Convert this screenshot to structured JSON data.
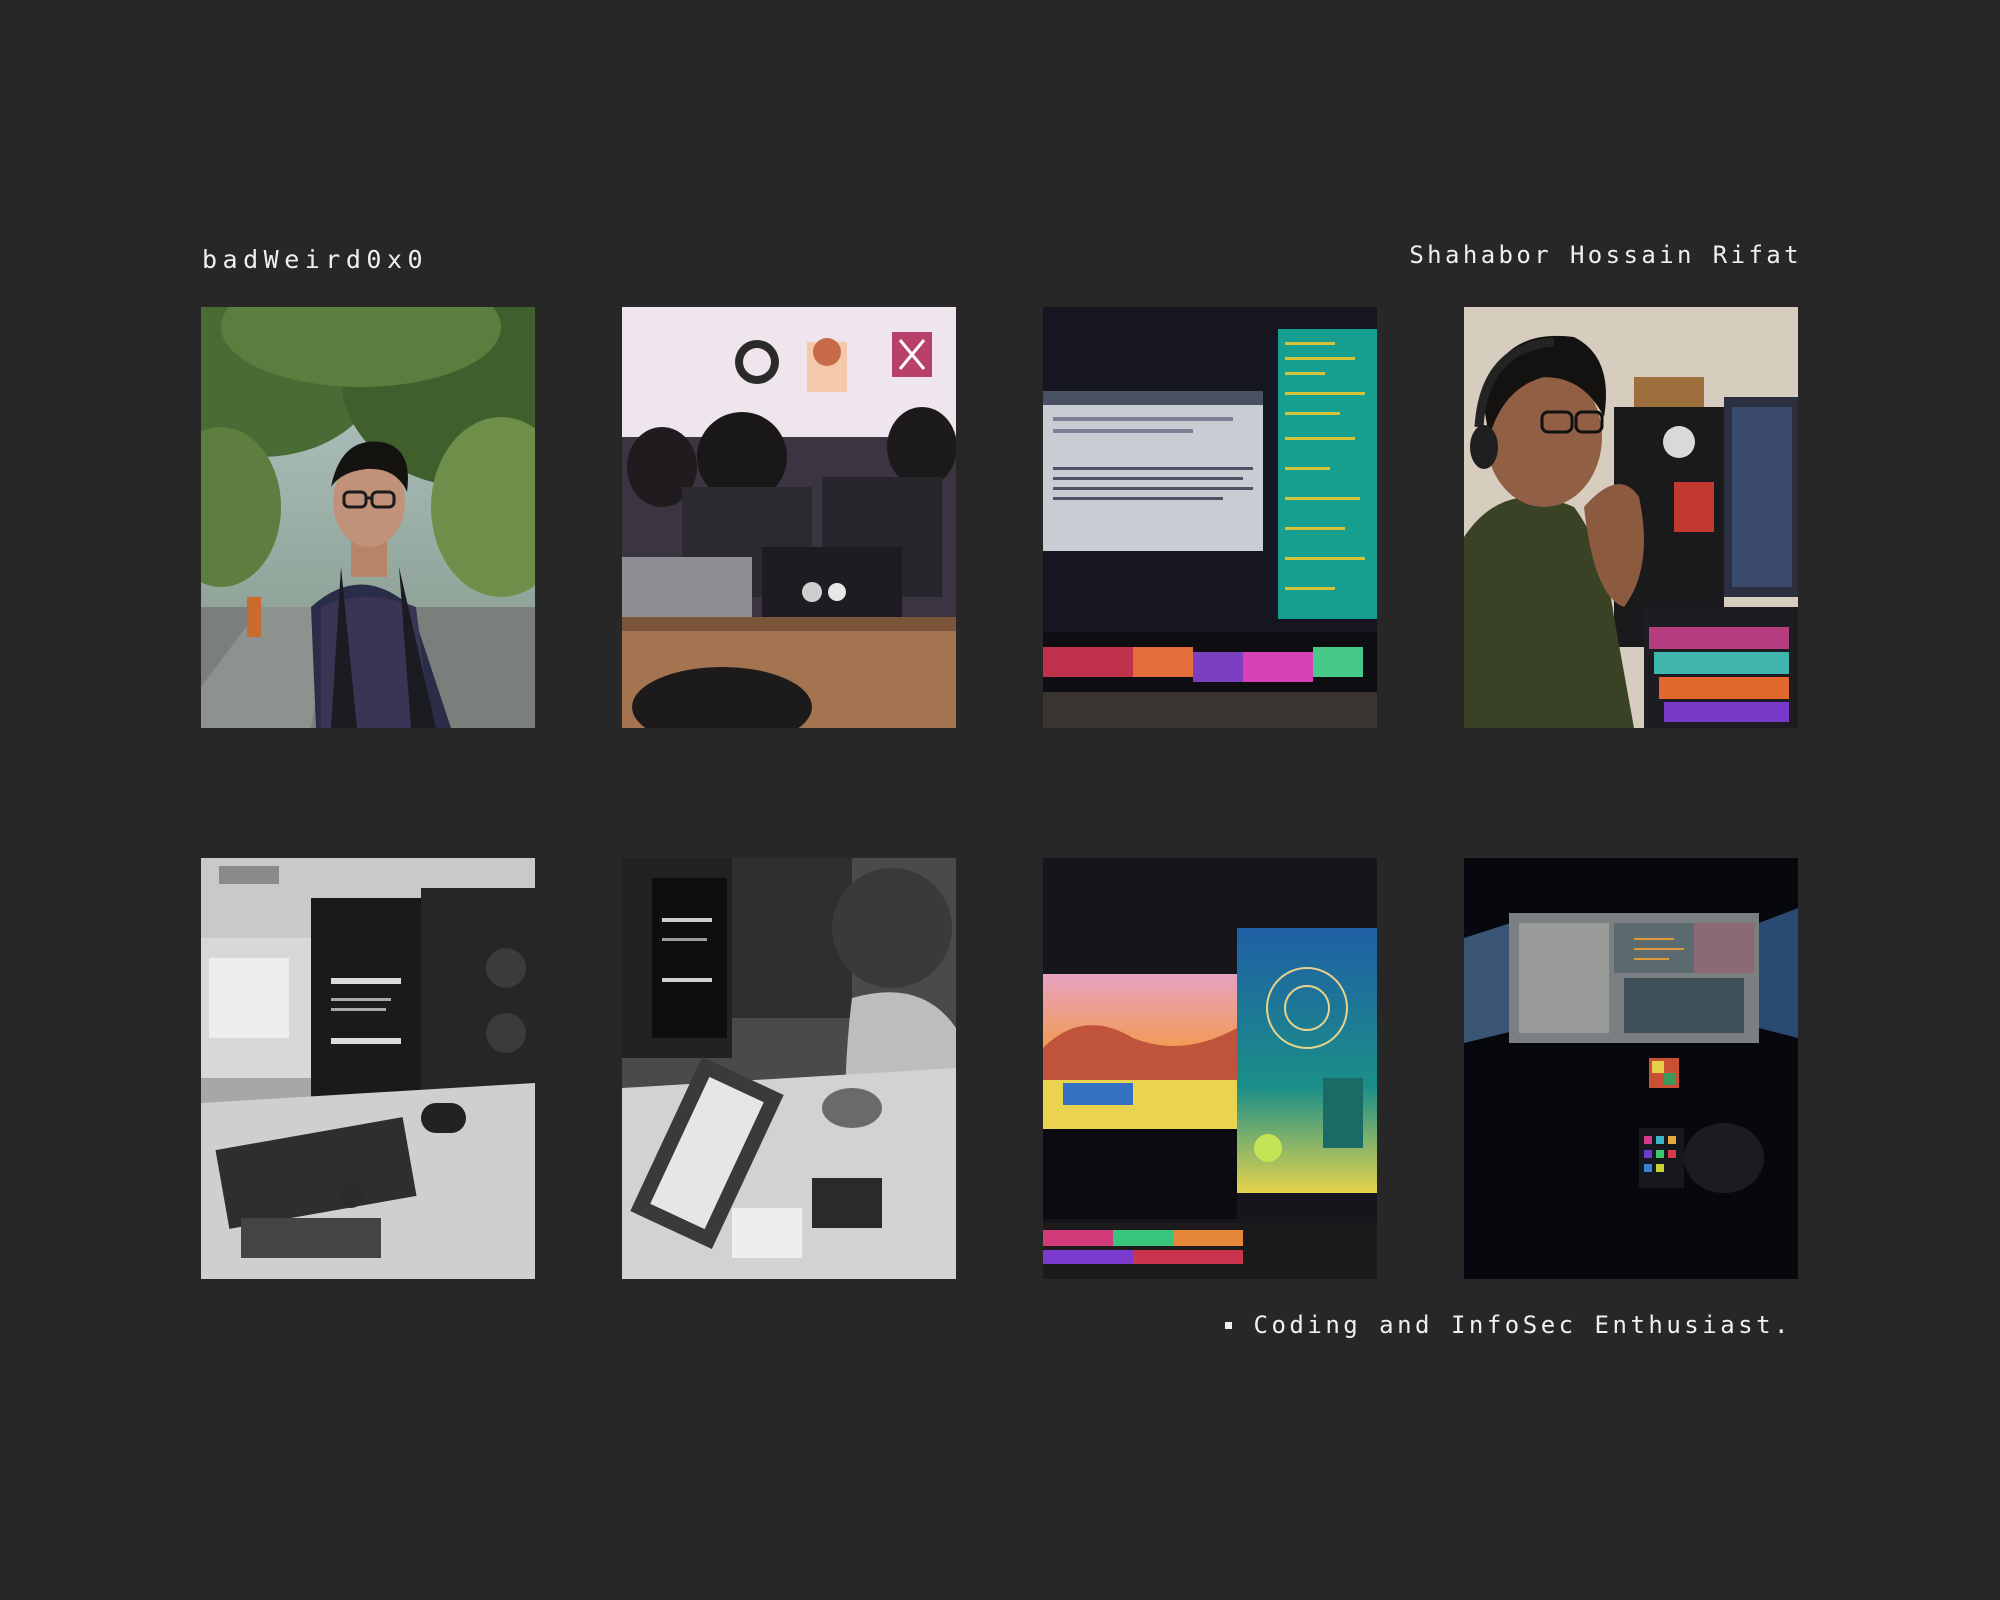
{
  "header": {
    "handle": "badWeird0x0",
    "full_name": "Shahabor Hossain Rifat"
  },
  "footer": {
    "tagline": "Coding and InfoSec Enthusiast."
  },
  "colors": {
    "background": "#272727",
    "text": "#efefef"
  },
  "photos": [
    {
      "subject": "portrait-outdoors"
    },
    {
      "subject": "workshop-laptops"
    },
    {
      "subject": "monitors-rgb-keyboard"
    },
    {
      "subject": "person-headphones-pc"
    },
    {
      "subject": "desk-grayscale-hacking-js-proxies"
    },
    {
      "subject": "soldering-grayscale"
    },
    {
      "subject": "gaming-setup-monitors"
    },
    {
      "subject": "dark-desk-monitors"
    }
  ]
}
